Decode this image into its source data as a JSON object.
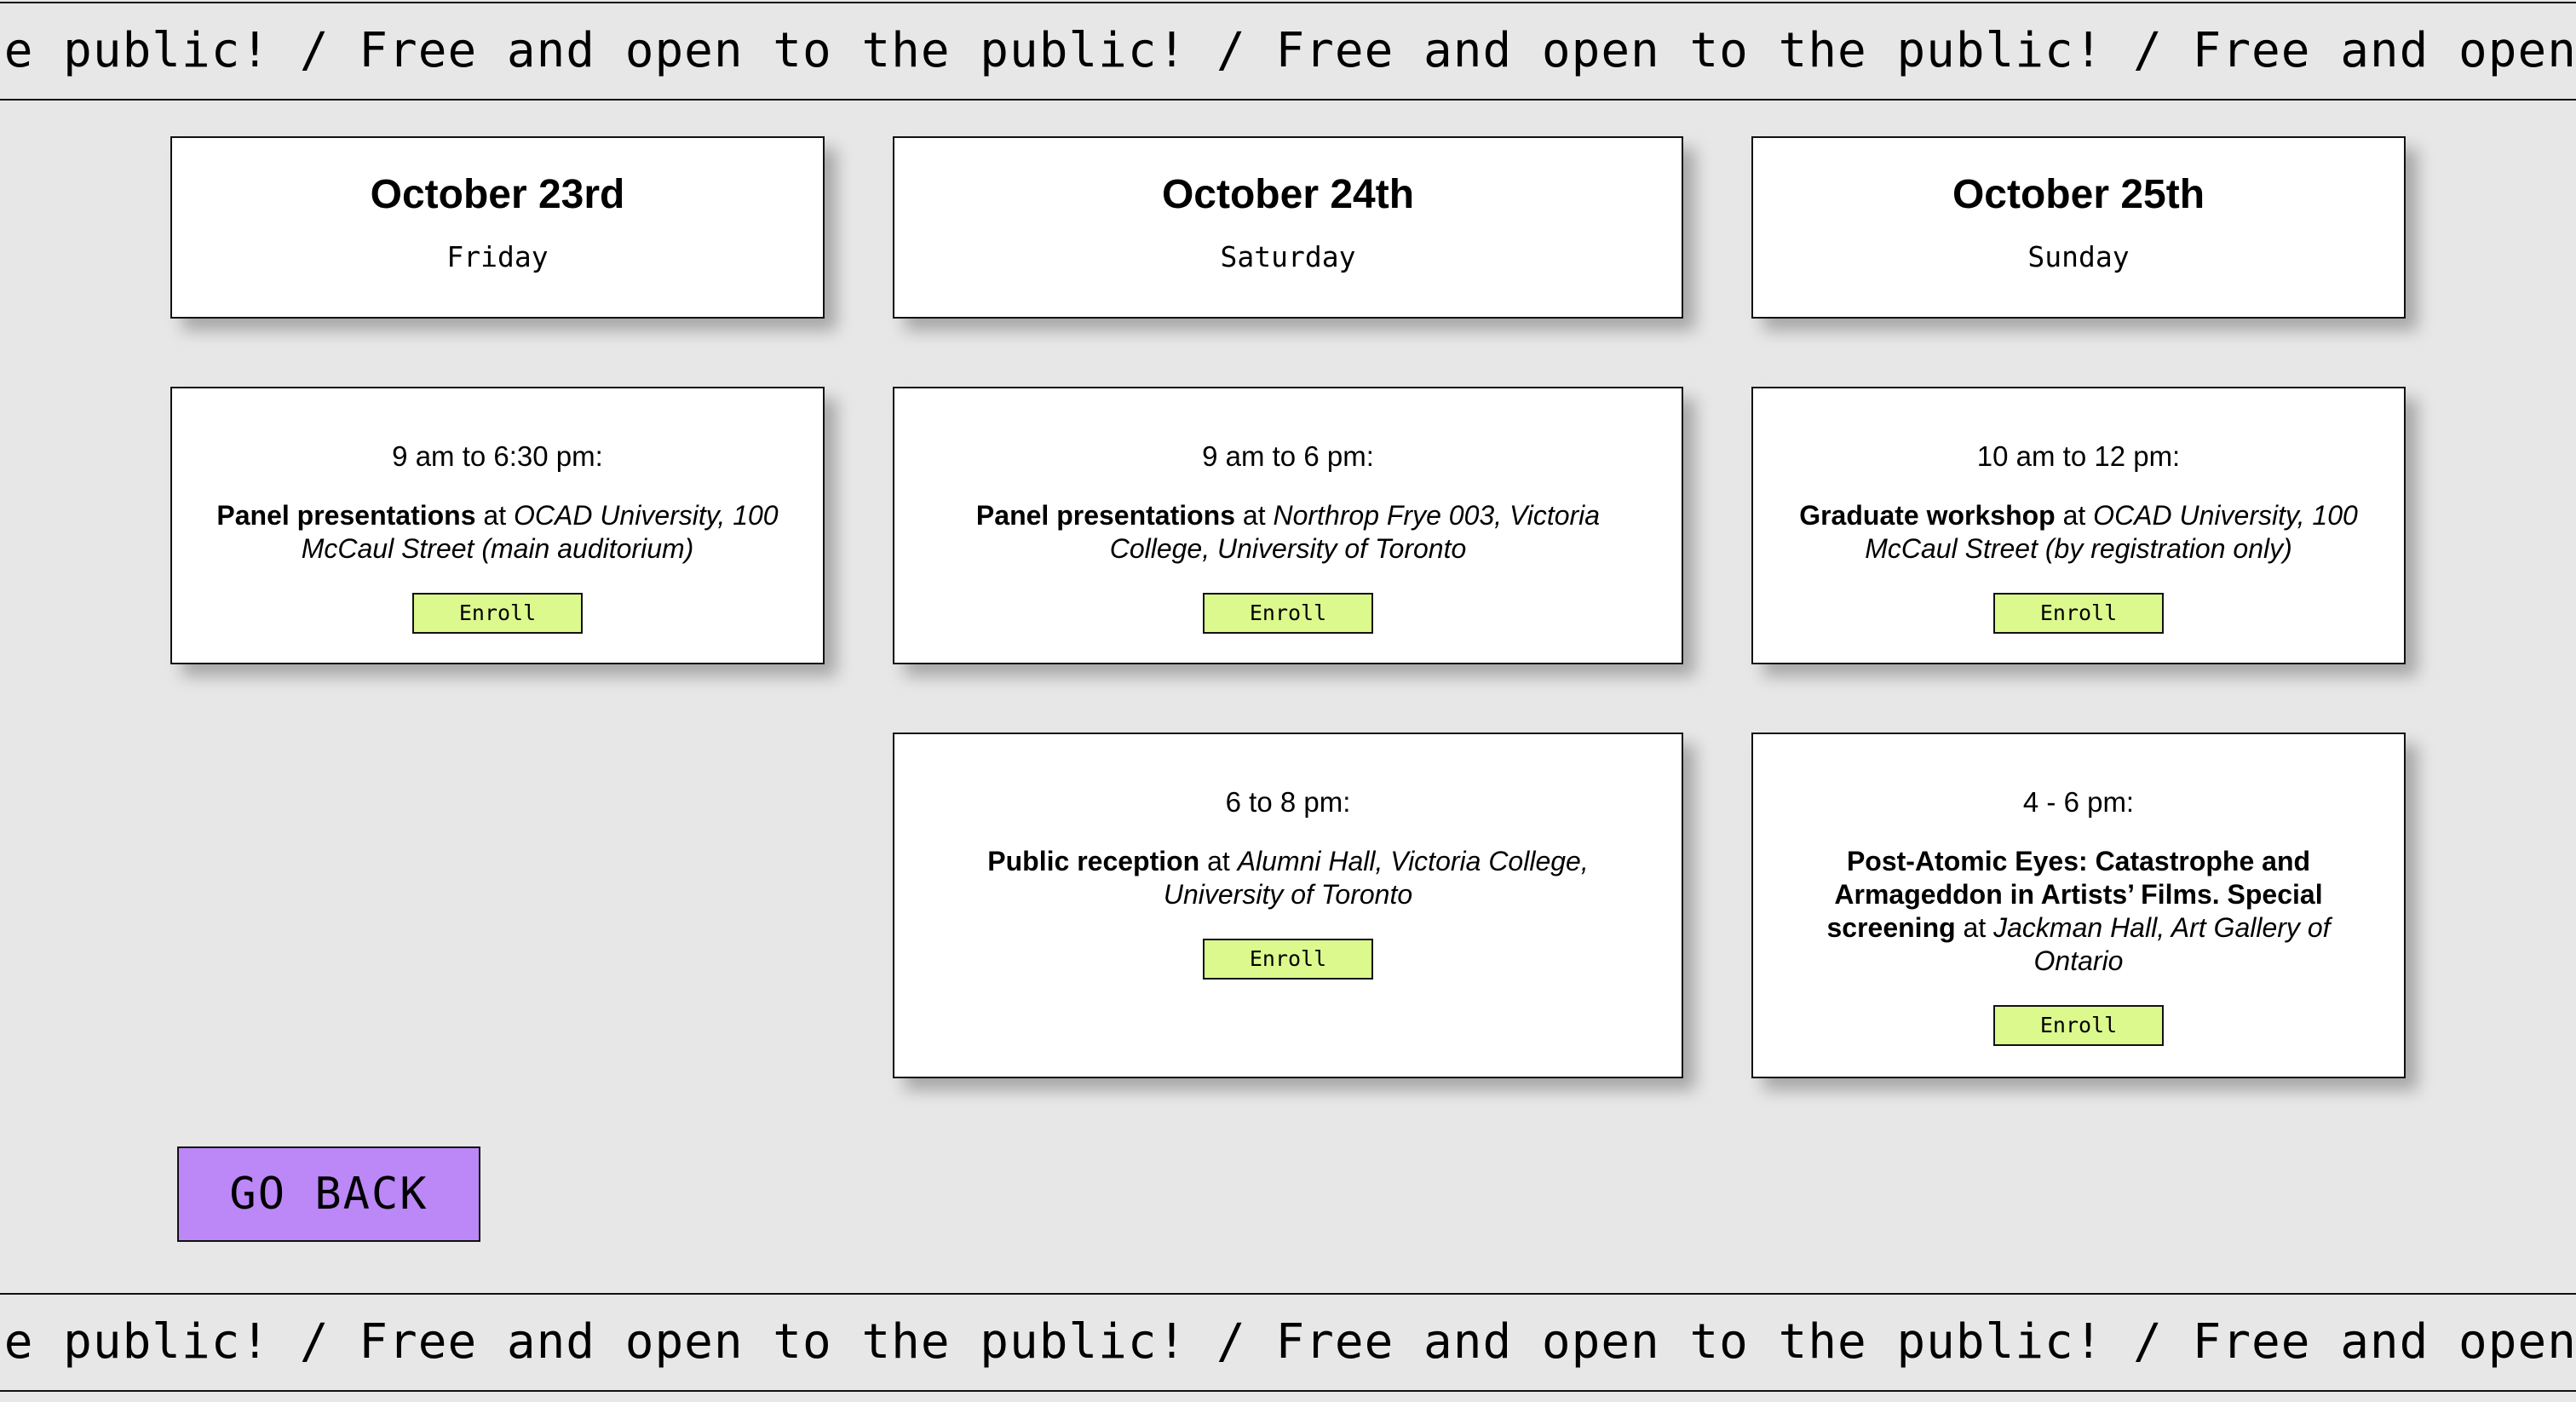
{
  "ticker": {
    "text": "ne public! / Free and open to the public! / Free and open to the public! / Free and open to the public! / Free and open to the"
  },
  "days": [
    {
      "date": "October 23rd",
      "weekday": "Friday"
    },
    {
      "date": "October 24th",
      "weekday": "Saturday"
    },
    {
      "date": "October 25th",
      "weekday": "Sunday"
    }
  ],
  "events": [
    {
      "time": "9 am to 6:30 pm:",
      "title": "Panel presentations",
      "connector": " at ",
      "place": "OCAD University, 100 McCaul Street (main auditorium)",
      "button": "Enroll"
    },
    {
      "time": "9 am to 6 pm:",
      "title": "Panel presentations",
      "connector": " at ",
      "place": "Northrop Frye 003, Victoria College, University of Toronto",
      "button": "Enroll"
    },
    {
      "time": "10 am to 12 pm:",
      "title": "Graduate workshop",
      "connector": " at ",
      "place": "OCAD University, 100 McCaul Street (by registration only)",
      "button": "Enroll"
    },
    {
      "time": "6 to 8 pm:",
      "title": "Public reception",
      "connector": " at ",
      "place": "Alumni Hall, Victoria College, University of Toronto",
      "button": "Enroll"
    },
    {
      "time": "4 - 6 pm:",
      "title": "Post-Atomic Eyes: Catastrophe and Armageddon in Artists’ Films. Special screening",
      "connector": " at ",
      "place": "Jackman Hall, Art Gallery of Ontario",
      "button": "Enroll"
    }
  ],
  "go_back": "GO BACK",
  "colors": {
    "background": "#e7e7e7",
    "enroll": "#dcf98d",
    "go_back": "#bc87f7"
  }
}
